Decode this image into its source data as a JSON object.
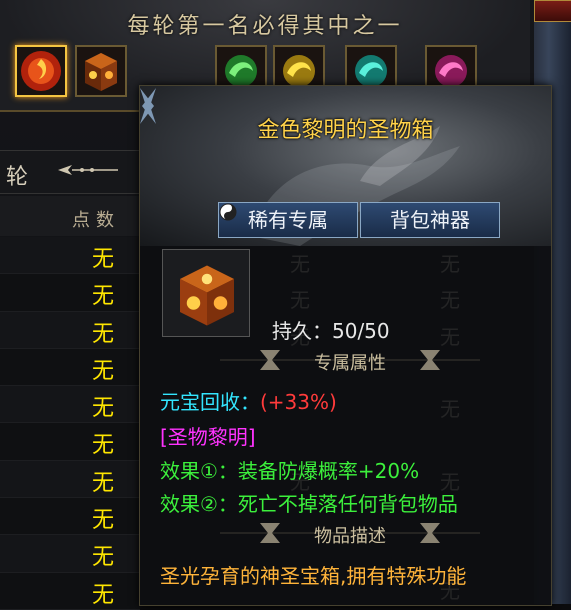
{
  "banner": {
    "title": "每轮第一名必得其中之一",
    "reward_icons": [
      "fire-orb-icon",
      "gold-box-icon",
      "green-dragon-icon",
      "gold-dragon-icon",
      "teal-dragon-icon",
      "pink-dragon-icon"
    ]
  },
  "ranking": {
    "round_label": "轮",
    "points_header": "点数",
    "rows": [
      "无",
      "无",
      "无",
      "无",
      "无",
      "无",
      "无",
      "无",
      "无",
      "无"
    ]
  },
  "tooltip": {
    "title": "金色黎明的圣物箱",
    "tag_rare": "稀有专属",
    "tag_bag": "背包神器",
    "durability": "持久：50/50",
    "section_exclusive": "专属属性",
    "ingot_label": "元宝回收：",
    "ingot_value": "(+33%)",
    "relic_name": "[圣物黎明]",
    "effect1": "效果①：装备防爆概率+20%",
    "effect2": "效果②：死亡不掉落任何背包物品",
    "section_desc": "物品描述",
    "description": "圣光孕育的神圣宝箱,拥有特殊功能"
  },
  "colors": {
    "title_gold": "#ffd24a",
    "none_yellow": "#ffe600",
    "ingot_cyan": "#33e6ff",
    "ingot_red": "#ff3b3b",
    "relic_magenta": "#ff33ff",
    "effect_green": "#3cf03c",
    "desc_orange": "#ffb43a"
  }
}
